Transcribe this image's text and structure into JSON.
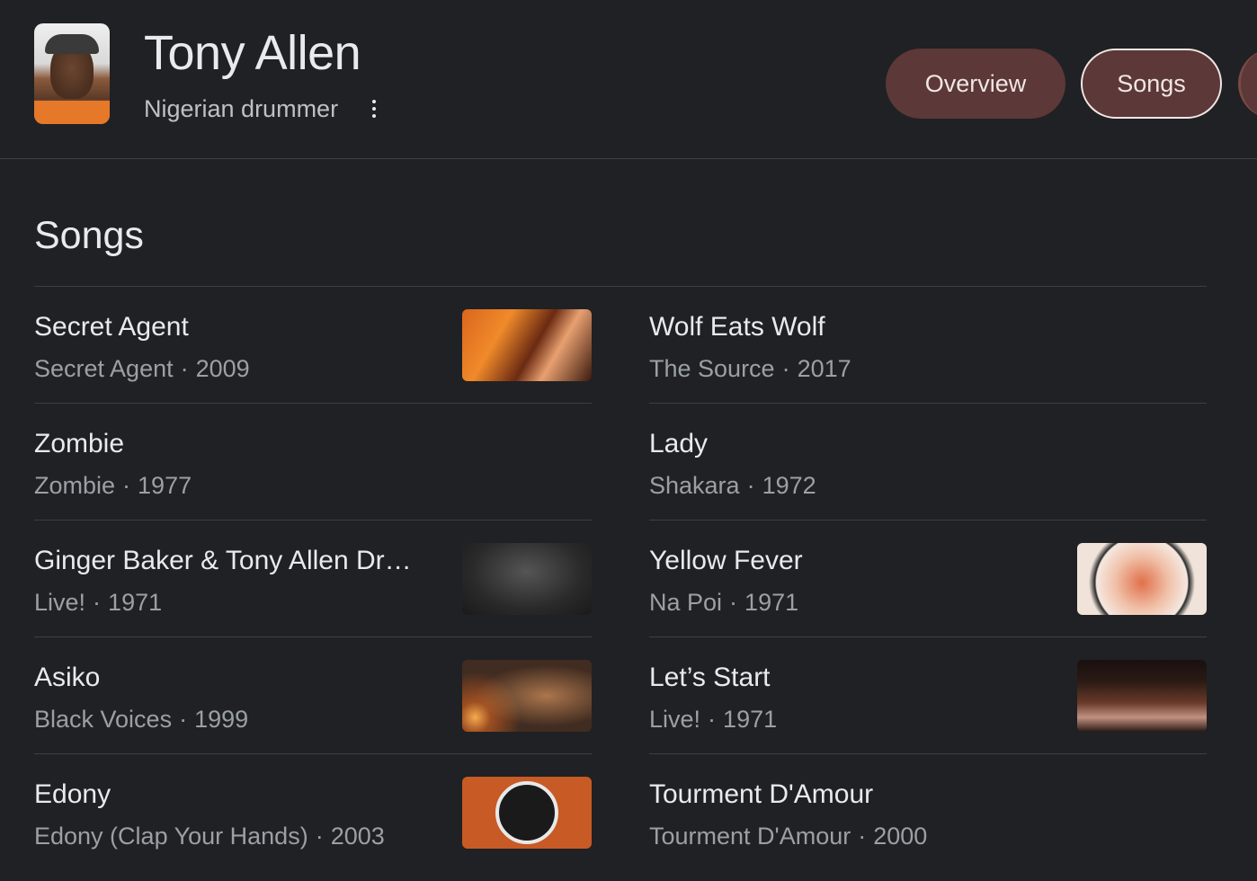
{
  "header": {
    "title": "Tony Allen",
    "subtitle": "Nigerian drummer",
    "tabs": [
      {
        "label": "Overview"
      },
      {
        "label": "Songs"
      }
    ]
  },
  "section": {
    "title": "Songs"
  },
  "songs_left": [
    {
      "title": "Secret Agent",
      "album": "Secret Agent",
      "year": "2009",
      "has_thumb": true
    },
    {
      "title": "Zombie",
      "album": "Zombie",
      "year": "1977",
      "has_thumb": false
    },
    {
      "title": "Ginger Baker & Tony Allen Dr…",
      "album": "Live!",
      "year": "1971",
      "has_thumb": true
    },
    {
      "title": "Asiko",
      "album": "Black Voices",
      "year": "1999",
      "has_thumb": true
    },
    {
      "title": "Edony",
      "album": "Edony (Clap Your Hands)",
      "year": "2003",
      "has_thumb": true
    }
  ],
  "songs_right": [
    {
      "title": "Wolf Eats Wolf",
      "album": "The Source",
      "year": "2017",
      "has_thumb": false
    },
    {
      "title": "Lady",
      "album": "Shakara",
      "year": "1972",
      "has_thumb": false
    },
    {
      "title": "Yellow Fever",
      "album": "Na Poi",
      "year": "1971",
      "has_thumb": true
    },
    {
      "title": "Let’s Start",
      "album": "Live!",
      "year": "1971",
      "has_thumb": true
    },
    {
      "title": "Tourment D'Amour",
      "album": "Tourment D'Amour",
      "year": "2000",
      "has_thumb": false
    }
  ],
  "separator": "·"
}
